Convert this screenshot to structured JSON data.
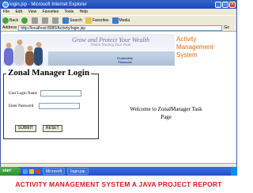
{
  "window": {
    "title": "login.jsp - Microsoft Internet Explorer"
  },
  "menu": [
    "File",
    "Edit",
    "View",
    "Favorites",
    "Tools",
    "Help"
  ],
  "toolbar": {
    "back_label": "Back",
    "search_label": "Search",
    "favorites_label": "Favorites",
    "media_label": "Media"
  },
  "address": {
    "label": "Address",
    "url": "http://localhost:8080/Activity/login.jsp",
    "go_label": "Go"
  },
  "banner": {
    "tagline": "Grow and Protect Your Wealth",
    "tagline_sub": "Widen Naming Your Pain",
    "logo_text": "Prudential Financial"
  },
  "brand": {
    "line1": "Activity",
    "line2": "Management",
    "line3": "System",
    "color": "#e06a12"
  },
  "login": {
    "title": "Zonal Manager Login",
    "username_label": "User Login Name",
    "password_label": "Enter Password",
    "submit_label": "SUBMIT",
    "reset_label": "RESET"
  },
  "welcome": {
    "line1": "Welcome to ZonalManager Task",
    "line2": "Page"
  },
  "taskbar": {
    "start_label": "start",
    "task1": "Microsoft",
    "task2": "login.jsp"
  },
  "caption": {
    "text": "ACTIVITY MANAGEMENT SYSTEM A JAVA PROJECT REPORT",
    "color": "#d81c1c"
  }
}
